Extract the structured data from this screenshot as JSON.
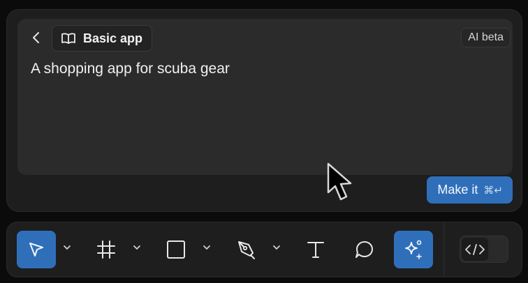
{
  "header": {
    "mode_label": "Basic app",
    "beta_label": "AI beta"
  },
  "prompt": {
    "text": "A shopping app for scuba gear"
  },
  "actions": {
    "make_label": "Make it",
    "make_shortcut": "⌘↵"
  },
  "toolbar": {
    "tools": [
      "move",
      "frame",
      "rectangle",
      "pen",
      "text",
      "comment",
      "ai-actions"
    ],
    "active_tool": "move"
  },
  "colors": {
    "accent": "#2f6fba",
    "panel": "#1e1e1e",
    "input": "#2b2b2b"
  }
}
